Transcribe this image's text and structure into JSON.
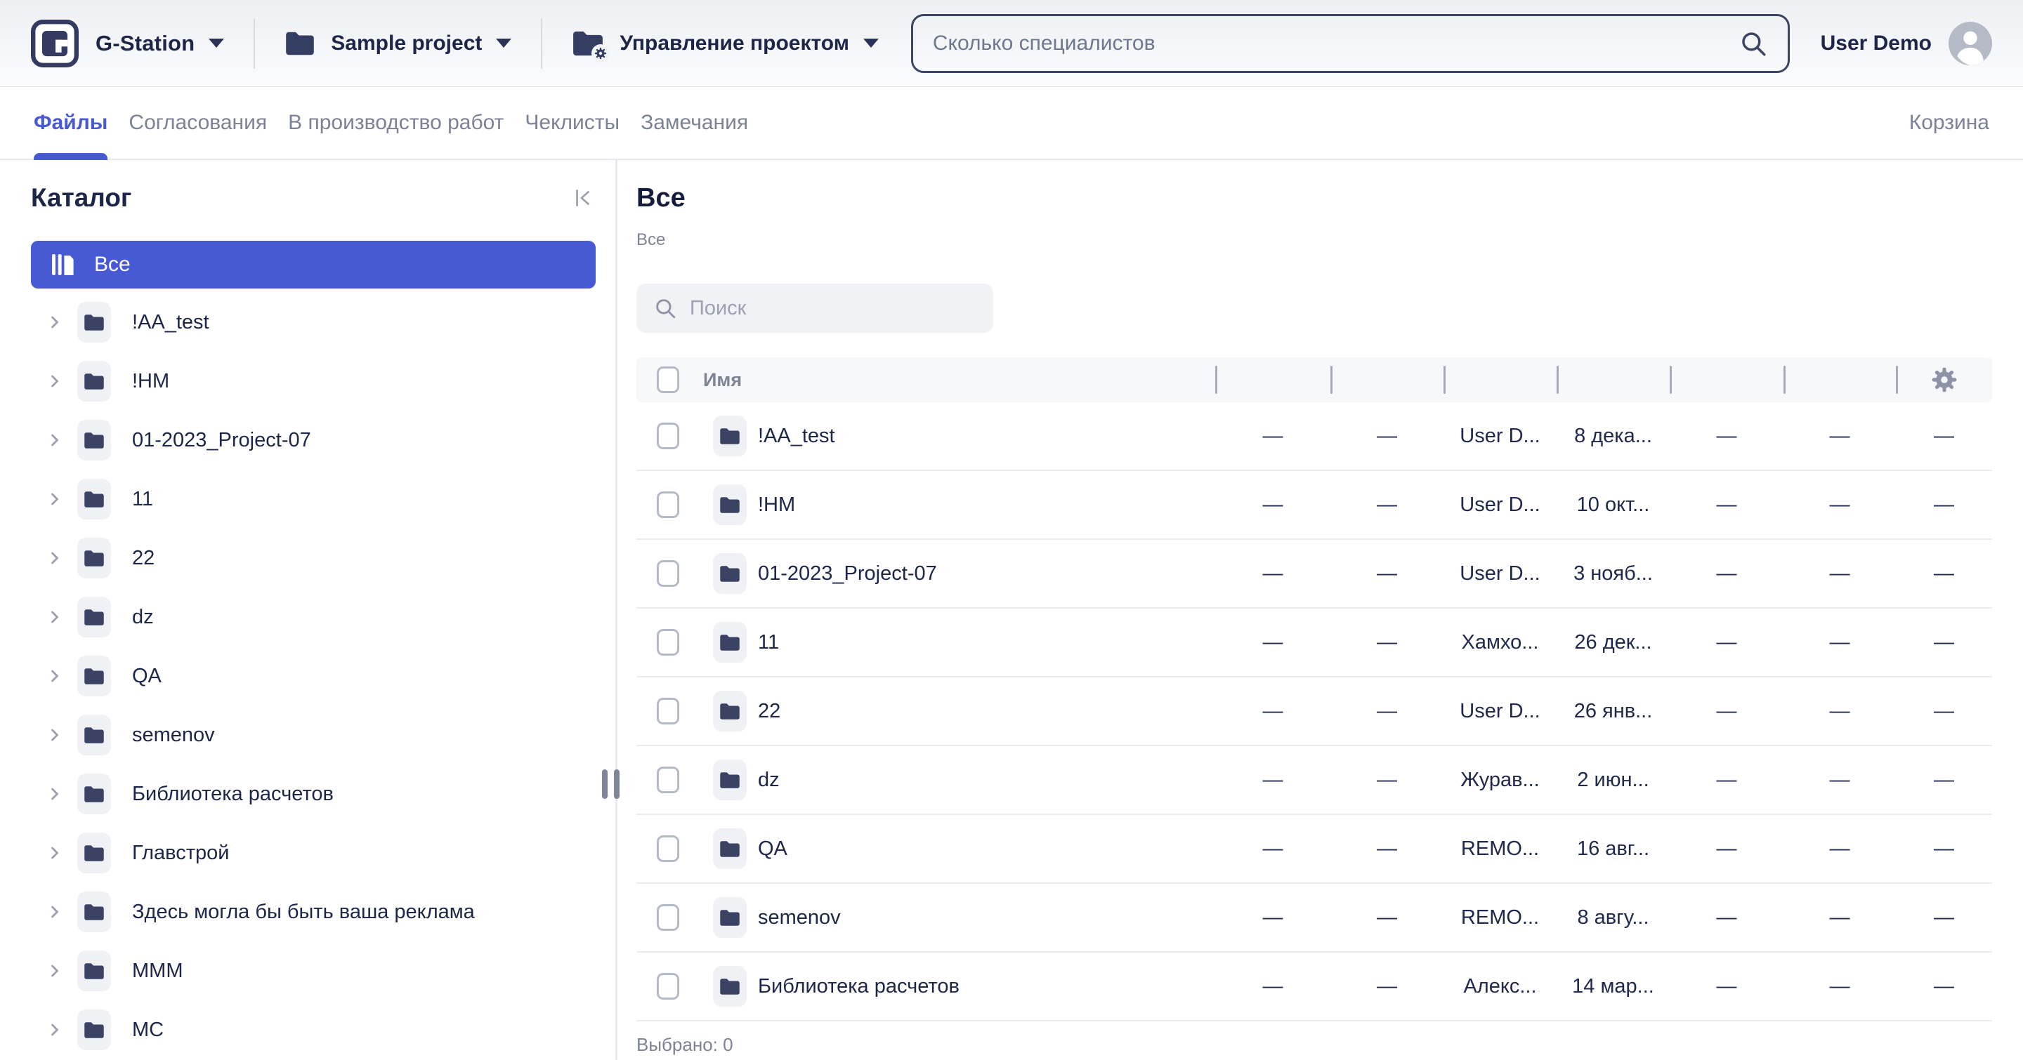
{
  "colors": {
    "accent": "#4859d4",
    "text_primary": "#1d2649",
    "text_muted": "#7d8494",
    "chip_bg": "#f0f1f4"
  },
  "topbar": {
    "app_name": "G-Station",
    "project_name": "Sample project",
    "module_name": "Управление проектом",
    "search_placeholder": "Сколько специалистов",
    "user_name": "User Demo"
  },
  "tabs": {
    "items": [
      {
        "label": "Файлы",
        "active": true
      },
      {
        "label": "Согласования",
        "active": false
      },
      {
        "label": "В производство работ",
        "active": false
      },
      {
        "label": "Чеклисты",
        "active": false
      },
      {
        "label": "Замечания",
        "active": false
      }
    ],
    "trash_label": "Корзина"
  },
  "sidebar": {
    "title": "Каталог",
    "all_item_label": "Все",
    "folders": [
      "!AA_test",
      "!HM",
      "01-2023_Project-07",
      "11",
      "22",
      "dz",
      "QA",
      "semenov",
      "Библиотека расчетов",
      "Главстрой",
      "Здесь могла бы быть ваша реклама",
      "МММ",
      "МС"
    ]
  },
  "main": {
    "title": "Все",
    "breadcrumb": "Все",
    "search_placeholder": "Поиск",
    "table": {
      "name_header": "Имя",
      "rows": [
        {
          "name": "!AA_test",
          "values": [
            "—",
            "—",
            "User D...",
            "8 дека...",
            "—",
            "—",
            "—"
          ]
        },
        {
          "name": "!HM",
          "values": [
            "—",
            "—",
            "User D...",
            "10 окт...",
            "—",
            "—",
            "—"
          ]
        },
        {
          "name": "01-2023_Project-07",
          "values": [
            "—",
            "—",
            "User D...",
            "3 нояб...",
            "—",
            "—",
            "—"
          ]
        },
        {
          "name": "11",
          "values": [
            "—",
            "—",
            "Хамхо...",
            "26 дек...",
            "—",
            "—",
            "—"
          ]
        },
        {
          "name": "22",
          "values": [
            "—",
            "—",
            "User D...",
            "26 янв...",
            "—",
            "—",
            "—"
          ]
        },
        {
          "name": "dz",
          "values": [
            "—",
            "—",
            "Журав...",
            "2 июн...",
            "—",
            "—",
            "—"
          ]
        },
        {
          "name": "QA",
          "values": [
            "—",
            "—",
            "REMO...",
            "16 авг...",
            "—",
            "—",
            "—"
          ]
        },
        {
          "name": "semenov",
          "values": [
            "—",
            "—",
            "REMO...",
            "8 авгу...",
            "—",
            "—",
            "—"
          ]
        },
        {
          "name": "Библиотека расчетов",
          "values": [
            "—",
            "—",
            "Алекс...",
            "14 мар...",
            "—",
            "—",
            "—"
          ]
        }
      ]
    },
    "selected_count_label": "Выбрано: 0"
  },
  "icons": {
    "logo": "g-station-logo",
    "dropdown": "chevron-down",
    "folder": "folder",
    "module": "folder-gear",
    "search": "magnifier",
    "avatar": "person-circle",
    "collapse": "collapse-panel-left",
    "tree_expand": "chevron-right",
    "settings": "gear",
    "drag": "drag-handle",
    "all": "library"
  }
}
